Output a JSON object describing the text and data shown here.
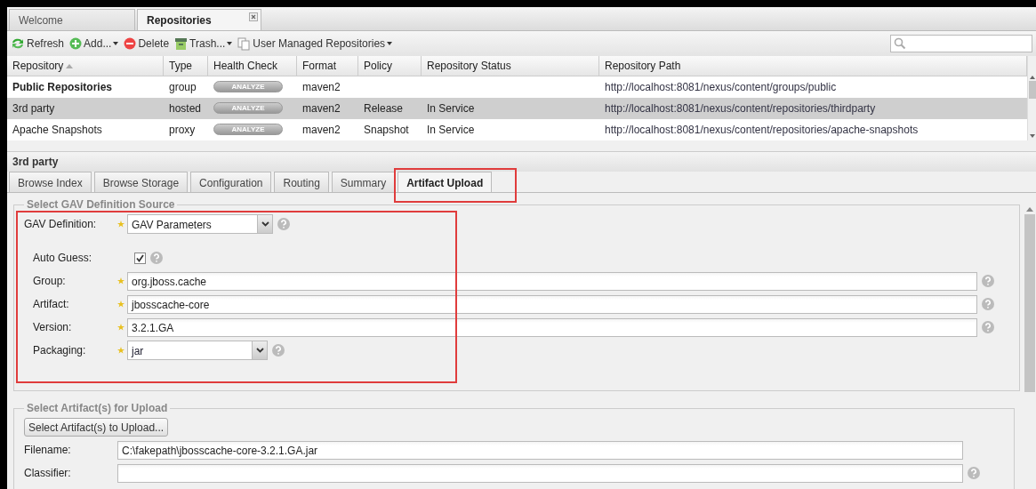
{
  "main_tabs": [
    {
      "label": "Welcome",
      "selected": false,
      "closable": false
    },
    {
      "label": "Repositories",
      "selected": true,
      "closable": true
    }
  ],
  "toolbar": [
    {
      "label": "Refresh",
      "menu": false
    },
    {
      "label": "Add...",
      "menu": true
    },
    {
      "label": "Delete",
      "menu": false
    },
    {
      "label": "Trash...",
      "menu": true
    },
    {
      "label": "User Managed Repositories",
      "menu": true
    }
  ],
  "table": {
    "columns": [
      {
        "label": "Repository",
        "sorted": true
      },
      {
        "label": "Type",
        "sorted": false
      },
      {
        "label": "Health Check",
        "sorted": false
      },
      {
        "label": "Format",
        "sorted": false
      },
      {
        "label": "Policy",
        "sorted": false
      },
      {
        "label": "Repository Status",
        "sorted": false
      },
      {
        "label": "Repository Path",
        "sorted": false
      }
    ],
    "rows": [
      {
        "name": "Public Repositories",
        "bold": true,
        "selected": false,
        "type": "group",
        "health": "ANALYZE",
        "format": "maven2",
        "path": "http://localhost:8081/nexus/content/groups/public"
      },
      {
        "name": "3rd party",
        "bold": false,
        "selected": true,
        "type": "hosted",
        "health": "ANALYZE",
        "format": "maven2",
        "policy": "Release",
        "status": "In Service",
        "path": "http://localhost:8081/nexus/content/repositories/thirdparty"
      },
      {
        "name": "Apache Snapshots",
        "bold": false,
        "selected": false,
        "type": "proxy",
        "health": "ANALYZE",
        "format": "maven2",
        "policy": "Snapshot",
        "status": "In Service",
        "path": "http://localhost:8081/nexus/content/repositories/apache-snapshots"
      }
    ]
  },
  "detail": {
    "title": "3rd party",
    "tabs": [
      {
        "label": "Browse Index",
        "selected": false
      },
      {
        "label": "Browse Storage",
        "selected": false
      },
      {
        "label": "Configuration",
        "selected": false
      },
      {
        "label": "Routing",
        "selected": false
      },
      {
        "label": "Summary",
        "selected": false
      },
      {
        "label": "Artifact Upload",
        "selected": true
      }
    ],
    "gav_section": {
      "legend": "Select GAV Definition Source",
      "fields": [
        {
          "kind": "select",
          "label": "GAV Definition:",
          "required": true,
          "value": "GAV Parameters",
          "help": true
        },
        {
          "kind": "checkbox",
          "label": "Auto Guess:",
          "required": false,
          "checked": true,
          "help": true
        },
        {
          "kind": "text",
          "label": "Group:",
          "required": true,
          "value": "org.jboss.cache",
          "help": true
        },
        {
          "kind": "text",
          "label": "Artifact:",
          "required": true,
          "value": "jbosscache-core",
          "help": true
        },
        {
          "kind": "text",
          "label": "Version:",
          "required": true,
          "value": "3.2.1.GA",
          "help": true
        },
        {
          "kind": "select",
          "label": "Packaging:",
          "required": true,
          "value": "jar",
          "help": true
        }
      ]
    },
    "upload_section": {
      "legend": "Select Artifact(s) for Upload",
      "button": "Select Artifact(s) to Upload...",
      "fields": [
        {
          "label": "Filename:",
          "value": "C:\\fakepath\\jbosscache-core-3.2.1.GA.jar",
          "help": false
        },
        {
          "label": "Classifier:",
          "help": true
        }
      ]
    }
  }
}
